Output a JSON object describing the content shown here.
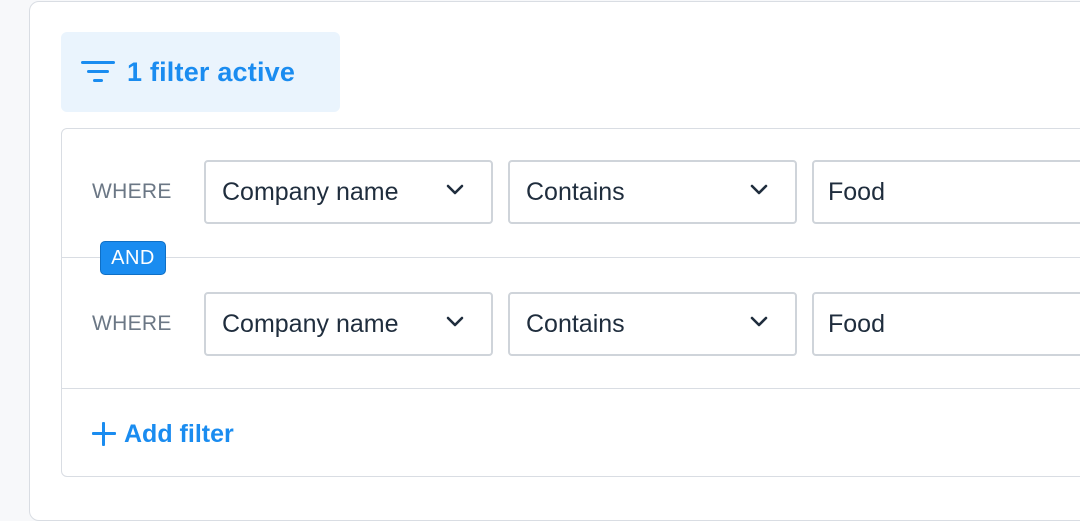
{
  "filter_toggle": {
    "label": "1 filter active",
    "icon": "filter-lines-icon"
  },
  "rules": [
    {
      "where_label": "WHERE",
      "field": "Company name",
      "operator": "Contains",
      "value": "Food"
    },
    {
      "where_label": "WHERE",
      "field": "Company name",
      "operator": "Contains",
      "value": "Food"
    }
  ],
  "conjunction": "AND",
  "add_filter": {
    "label": "Add filter",
    "icon": "plus-icon"
  },
  "colors": {
    "accent": "#1a8cf0",
    "toggle_bg": "#eaf4fd",
    "border": "#d9dde3",
    "text": "#1f2d3d",
    "muted": "#6b7785"
  }
}
